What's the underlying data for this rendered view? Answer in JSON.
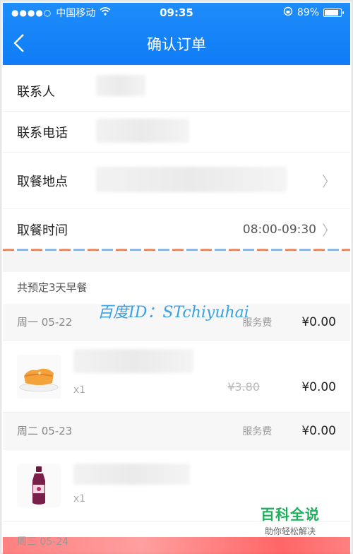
{
  "status": {
    "carrier": "中国移动",
    "time": "09:35",
    "battery": "89%",
    "battery_level": 0.89
  },
  "nav": {
    "title": "确认订单"
  },
  "contact": {
    "rows": [
      {
        "label": "联系人"
      },
      {
        "label": "联系电话"
      },
      {
        "label": "取餐地点"
      },
      {
        "label": "取餐时间",
        "value": "08:00-09:30"
      }
    ]
  },
  "order": {
    "heading": "共预定3天早餐",
    "days": [
      {
        "day": "周一 05-22",
        "service": "服务费",
        "amount": "¥0.00"
      },
      {
        "day": "周二 05-23",
        "service": "服务费",
        "amount": "¥0.00"
      },
      {
        "day": "周三 05-24"
      }
    ],
    "items": [
      {
        "qty": "x1",
        "original": "¥3.80",
        "price": "¥0.00"
      },
      {
        "qty": "x1"
      }
    ]
  },
  "watermark": "百度ID：STchiyuhai",
  "brand": {
    "name": "百科全说",
    "tagline": "助你轻松解决"
  }
}
